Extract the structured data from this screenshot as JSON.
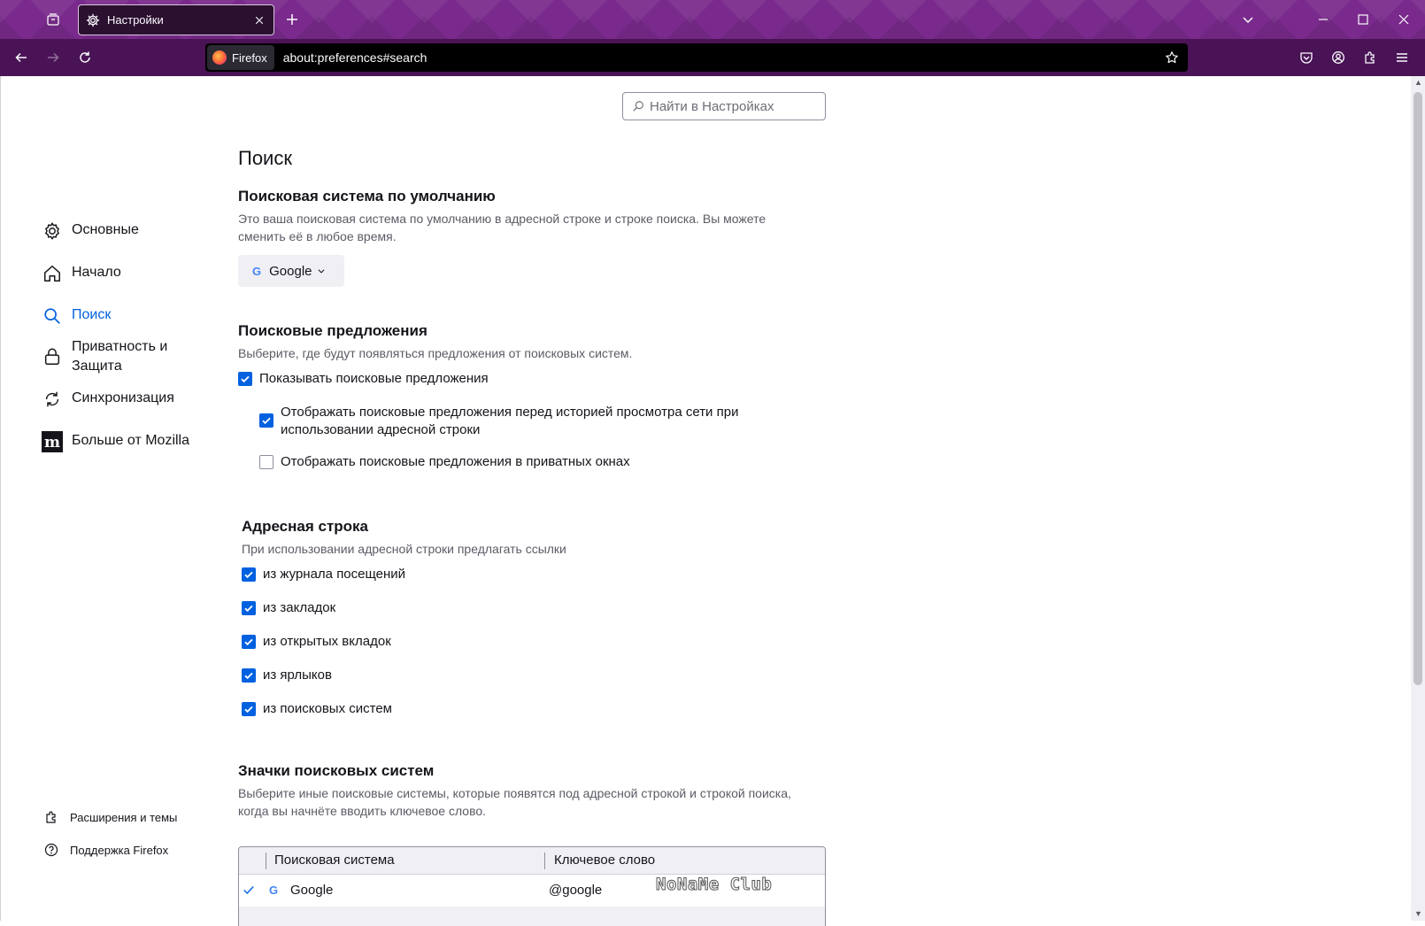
{
  "browser": {
    "tab_title": "Настройки",
    "identity_label": "Firefox",
    "url": "about:preferences#search"
  },
  "search": {
    "placeholder": "Найти в Настройках"
  },
  "sidebar": {
    "items": [
      {
        "label": "Основные",
        "icon": "gear-icon"
      },
      {
        "label": "Начало",
        "icon": "home-icon"
      },
      {
        "label": "Поиск",
        "icon": "search-icon",
        "active": true
      },
      {
        "label": "Приватность и Защита",
        "icon": "lock-icon"
      },
      {
        "label": "Синхронизация",
        "icon": "sync-icon"
      },
      {
        "label": "Больше от Mozilla",
        "icon": "mozilla-icon"
      }
    ],
    "footer": [
      {
        "label": "Расширения и темы",
        "icon": "puzzle-icon"
      },
      {
        "label": "Поддержка Firefox",
        "icon": "help-icon"
      }
    ]
  },
  "page": {
    "title": "Поиск",
    "default_engine": {
      "heading": "Поисковая система по умолчанию",
      "description": "Это ваша поисковая система по умолчанию в адресной строке и строке поиска. Вы можете сменить её в любое время.",
      "selected": "Google"
    },
    "suggestions": {
      "heading": "Поисковые предложения",
      "description": "Выберите, где будут появляться предложения от поисковых систем.",
      "show_label": "Показывать поисковые предложения",
      "before_history_label": "Отображать поисковые предложения перед историей просмотра сети при использовании адресной строки",
      "private_label": "Отображать поисковые предложения в приватных окнах",
      "show_checked": true,
      "before_history_checked": true,
      "private_checked": false
    },
    "address_bar": {
      "heading": "Адресная строка",
      "description": "При использовании адресной строки предлагать ссылки",
      "options": [
        {
          "label": "из журнала посещений",
          "checked": true
        },
        {
          "label": "из закладок",
          "checked": true
        },
        {
          "label": "из открытых вкладок",
          "checked": true
        },
        {
          "label": "из ярлыков",
          "checked": true
        },
        {
          "label": "из поисковых систем",
          "checked": true
        }
      ]
    },
    "shortcuts": {
      "heading": "Значки поисковых систем",
      "description": "Выберите иные поисковые системы, которые появятся под адресной строкой и строкой поиска, когда вы начнёте вводить ключевое слово.",
      "columns": [
        "Поисковая система",
        "Ключевое слово"
      ],
      "rows": [
        {
          "engine": "Google",
          "keyword": "@google",
          "checked": true
        }
      ]
    }
  },
  "watermark": "NoNaMe Club",
  "colors": {
    "accent": "#0061e0",
    "titlebar": "#7a2a8c",
    "toolbar": "#4a1356"
  }
}
